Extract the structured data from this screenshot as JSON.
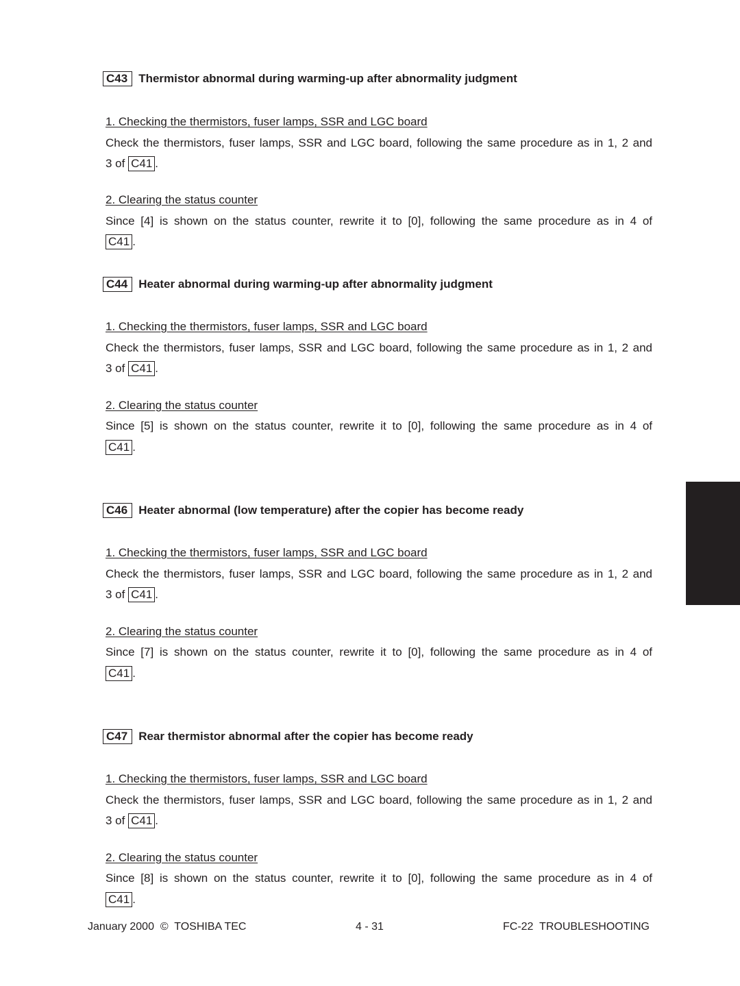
{
  "sections": [
    {
      "code": "C43",
      "title": "Thermistor abnormal during warming-up after abnormality judgment",
      "step1_title": "1. Checking the thermistors, fuser lamps, SSR and LGC board",
      "step1_text": "Check the thermistors, fuser lamps, SSR and LGC board, following the same procedure as in 1, 2 and",
      "step1_cont_prefix": "3 of",
      "step1_ref": "C41",
      "step2_title": "2. Clearing the status counter",
      "step2_text": "Since [4] is shown on the status counter, rewrite it to [0], following the same procedure as in 4 of",
      "step2_ref": "C41"
    },
    {
      "code": "C44",
      "title": "Heater abnormal during warming-up after abnormality judgment",
      "step1_title": "1. Checking the thermistors, fuser lamps, SSR and LGC board",
      "step1_text": "Check the thermistors, fuser lamps, SSR and LGC board, following the same procedure as in 1, 2 and",
      "step1_cont_prefix": "3 of",
      "step1_ref": "C41",
      "step2_title": "2. Clearing the status counter",
      "step2_text": "Since [5] is shown on the status counter, rewrite it to [0], following the same procedure as in 4 of",
      "step2_ref": "C41"
    },
    {
      "code": "C46",
      "title": "Heater abnormal (low temperature) after the copier has become ready",
      "step1_title": "1. Checking the thermistors, fuser lamps, SSR and LGC board",
      "step1_text": "Check the thermistors, fuser lamps, SSR and LGC board, following the same procedure as in 1, 2 and",
      "step1_cont_prefix": "3 of",
      "step1_ref": "C41",
      "step2_title": "2. Clearing the status counter",
      "step2_text": "Since [7] is shown on the status counter, rewrite it to [0], following the same procedure as in 4 of",
      "step2_ref": "C41"
    },
    {
      "code": "C47",
      "title": "Rear thermistor abnormal after the copier has become ready",
      "step1_title": "1. Checking the thermistors, fuser lamps, SSR and LGC board",
      "step1_text": "Check the thermistors, fuser lamps, SSR and LGC board, following the same procedure as in 1, 2 and",
      "step1_cont_prefix": "3 of",
      "step1_ref": "C41",
      "step2_title": "2. Clearing the status counter",
      "step2_text": "Since [8] is shown on the status counter, rewrite it to [0], following the same procedure as in 4 of",
      "step2_ref": "C41"
    }
  ],
  "punctuation": {
    "period": "."
  },
  "footer": {
    "left": "January 2000  ©  TOSHIBA TEC",
    "center": "4 - 31",
    "right": "FC-22  TROUBLESHOOTING"
  },
  "colors": {
    "text": "#231f20",
    "side_tab": "#231f20"
  }
}
